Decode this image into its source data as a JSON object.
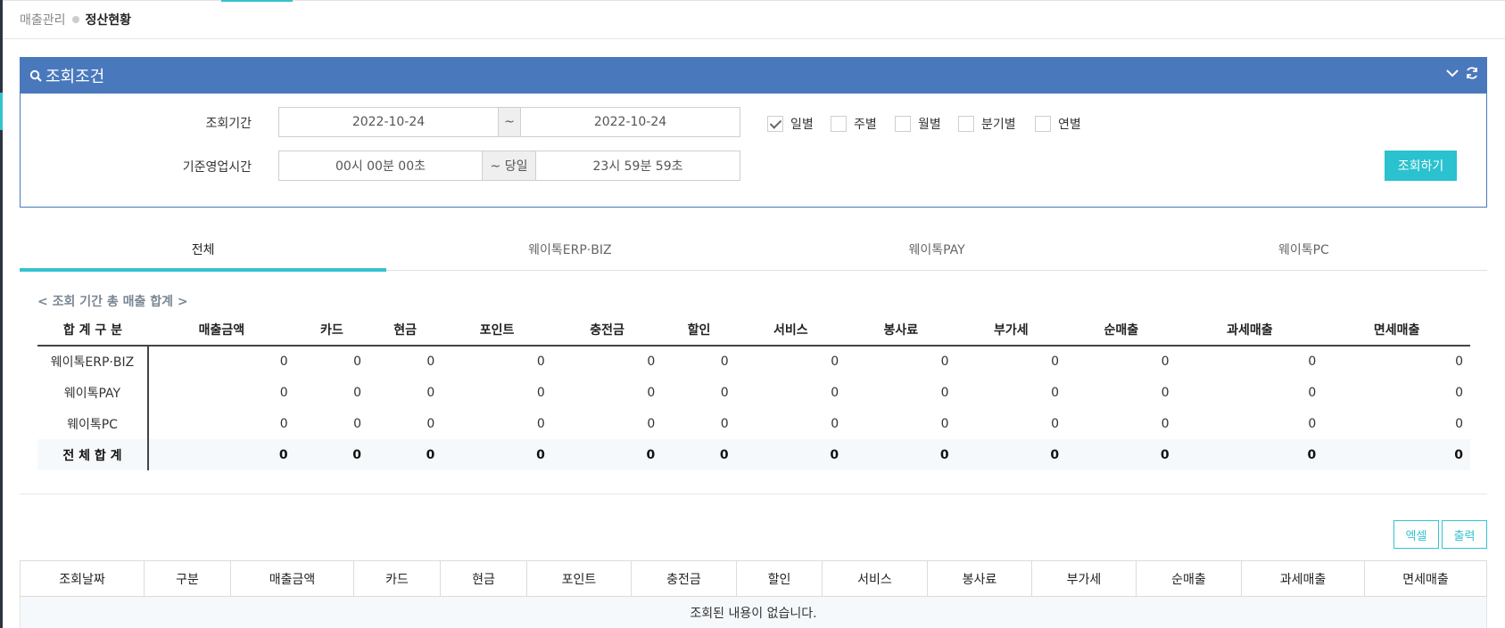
{
  "breadcrumb": {
    "parent": "매출관리",
    "current": "정산현황"
  },
  "search_panel": {
    "title": "조회조건",
    "period_label": "조회기간",
    "date_from": "2022-10-24",
    "date_sep": "~",
    "date_to": "2022-10-24",
    "biz_time_label": "기준영업시간",
    "time_from": "00시 00분 00초",
    "time_sep": "~ 당일",
    "time_to": "23시 59분 59초",
    "period_options": [
      {
        "label": "일별",
        "checked": true
      },
      {
        "label": "주별",
        "checked": false
      },
      {
        "label": "월별",
        "checked": false
      },
      {
        "label": "분기별",
        "checked": false
      },
      {
        "label": "연별",
        "checked": false
      }
    ],
    "search_button": "조회하기"
  },
  "tabs": [
    {
      "label": "전체",
      "active": true
    },
    {
      "label": "웨이톡ERP·BIZ",
      "active": false
    },
    {
      "label": "웨이톡PAY",
      "active": false
    },
    {
      "label": "웨이톡PC",
      "active": false
    }
  ],
  "summary": {
    "caption": "< 조회 기간 총 매출 합계 >",
    "columns": [
      "합 계 구 분",
      "매출금액",
      "카드",
      "현금",
      "포인트",
      "충전금",
      "할인",
      "서비스",
      "봉사료",
      "부가세",
      "순매출",
      "과세매출",
      "면세매출"
    ],
    "rows": [
      {
        "name": "웨이톡ERP·BIZ",
        "values": [
          "0",
          "0",
          "0",
          "0",
          "0",
          "0",
          "0",
          "0",
          "0",
          "0",
          "0",
          "0"
        ]
      },
      {
        "name": "웨이톡PAY",
        "values": [
          "0",
          "0",
          "0",
          "0",
          "0",
          "0",
          "0",
          "0",
          "0",
          "0",
          "0",
          "0"
        ]
      },
      {
        "name": "웨이톡PC",
        "values": [
          "0",
          "0",
          "0",
          "0",
          "0",
          "0",
          "0",
          "0",
          "0",
          "0",
          "0",
          "0"
        ]
      }
    ],
    "total": {
      "name": "전 체 합 계",
      "values": [
        "0",
        "0",
        "0",
        "0",
        "0",
        "0",
        "0",
        "0",
        "0",
        "0",
        "0",
        "0"
      ]
    }
  },
  "actions": {
    "excel": "엑셀",
    "print": "출력"
  },
  "detail": {
    "columns": [
      "조회날짜",
      "구분",
      "매출금액",
      "카드",
      "현금",
      "포인트",
      "충전금",
      "할인",
      "서비스",
      "봉사료",
      "부가세",
      "순매출",
      "과세매출",
      "면세매출"
    ],
    "empty_message": "조회된 내용이 없습니다."
  },
  "colors": {
    "primary": "#4a78bd",
    "accent": "#2bc2cf"
  }
}
